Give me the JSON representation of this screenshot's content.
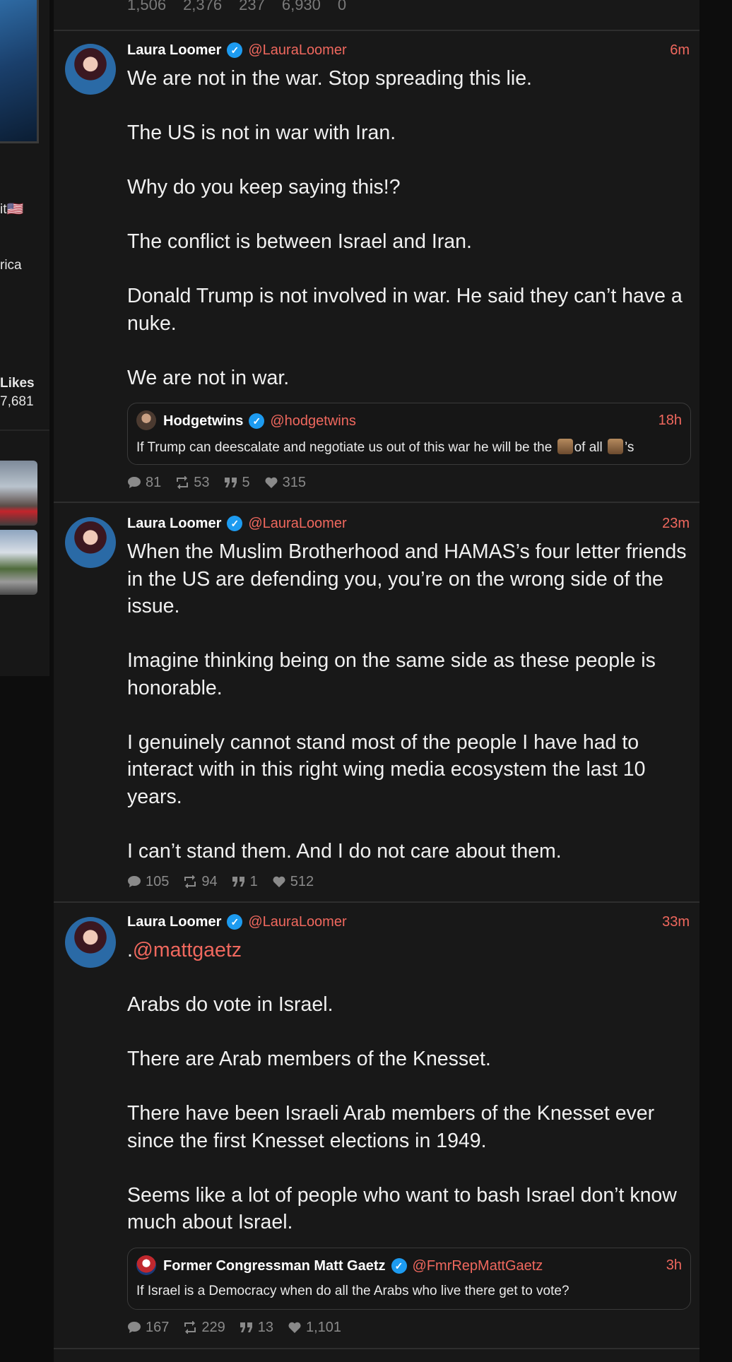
{
  "sidebar": {
    "fragments": [
      "it🇺🇸",
      "rica",
      "Likes",
      "7,681"
    ]
  },
  "top_stats": [
    "1,506",
    "2,376",
    "237",
    "6,930",
    "0"
  ],
  "posts": [
    {
      "author": "Laura Loomer",
      "handle": "@LauraLoomer",
      "time": "6m",
      "paragraphs": [
        "We are not in the war. Stop spreading this lie.",
        "",
        "The US is not in war with Iran.",
        "",
        "Why do you keep saying this!?",
        "",
        "The conflict is between Israel and Iran.",
        "",
        "Donald Trump is not involved in war. He said they can’t have a nuke.",
        "",
        "We are not in war."
      ],
      "quote": {
        "author": "Hodgetwins",
        "handle": "@hodgetwins",
        "time": "18h",
        "text_a": "If Trump can deescalate and negotiate us out of this war he will be the",
        "text_b": "of all",
        "text_c": "’s"
      },
      "stats": {
        "replies": "81",
        "reposts": "53",
        "quotes": "5",
        "likes": "315"
      }
    },
    {
      "author": "Laura Loomer",
      "handle": "@LauraLoomer",
      "time": "23m",
      "paragraphs": [
        "When the Muslim Brotherhood and HAMAS’s four letter friends in the US are defending you, you’re on the wrong side of the issue.",
        "",
        "Imagine thinking being on the same side as these people is honorable.",
        "",
        "I genuinely cannot stand most of the people I have had to interact with in this right wing media ecosystem the last 10 years.",
        "",
        "I can’t stand them. And I do not care about them."
      ],
      "stats": {
        "replies": "105",
        "reposts": "94",
        "quotes": "1",
        "likes": "512"
      }
    },
    {
      "author": "Laura Loomer",
      "handle": "@LauraLoomer",
      "time": "33m",
      "mention": "@mattgaetz",
      "paragraphs": [
        "",
        "Arabs do vote in Israel.",
        "",
        "There are Arab members of the Knesset.",
        "",
        "There have been Israeli Arab members of the Knesset ever since the first Knesset elections in 1949.",
        "",
        "Seems like a lot of people who want to bash Israel don’t know much about Israel."
      ],
      "quote": {
        "author": "Former Congressman Matt Gaetz",
        "handle": "@FmrRepMattGaetz",
        "time": "3h",
        "text": "If Israel is a Democracy when do all the Arabs who live there get to vote?"
      },
      "stats": {
        "replies": "167",
        "reposts": "229",
        "quotes": "13",
        "likes": "1,101"
      }
    }
  ],
  "colors": {
    "accent": "#f0685e",
    "verified": "#1d9bf0",
    "background": "#181818"
  }
}
